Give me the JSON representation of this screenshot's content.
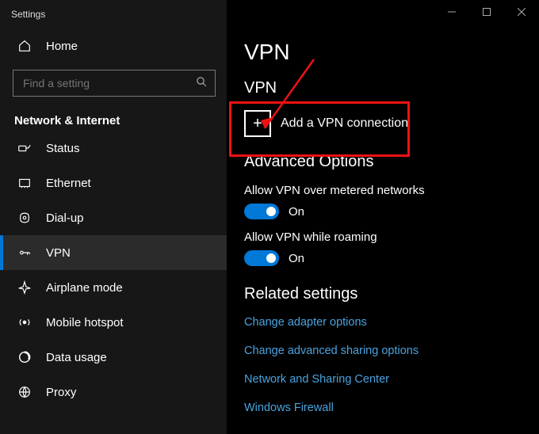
{
  "window": {
    "title": "Settings"
  },
  "sidebar": {
    "home_label": "Home",
    "search_placeholder": "Find a setting",
    "category": "Network & Internet",
    "items": [
      {
        "label": "Status",
        "icon": "status-icon"
      },
      {
        "label": "Ethernet",
        "icon": "ethernet-icon"
      },
      {
        "label": "Dial-up",
        "icon": "dialup-icon"
      },
      {
        "label": "VPN",
        "icon": "vpn-icon"
      },
      {
        "label": "Airplane mode",
        "icon": "airplane-icon"
      },
      {
        "label": "Mobile hotspot",
        "icon": "hotspot-icon"
      },
      {
        "label": "Data usage",
        "icon": "datausage-icon"
      },
      {
        "label": "Proxy",
        "icon": "proxy-icon"
      }
    ]
  },
  "main": {
    "page_title": "VPN",
    "section_vpn": "VPN",
    "add_vpn_label": "Add a VPN connection",
    "section_advanced": "Advanced Options",
    "opt_metered": {
      "label": "Allow VPN over metered networks",
      "state": "On"
    },
    "opt_roaming": {
      "label": "Allow VPN while roaming",
      "state": "On"
    },
    "section_related": "Related settings",
    "links": [
      "Change adapter options",
      "Change advanced sharing options",
      "Network and Sharing Center",
      "Windows Firewall"
    ]
  },
  "annotation": {
    "color": "#e11"
  }
}
